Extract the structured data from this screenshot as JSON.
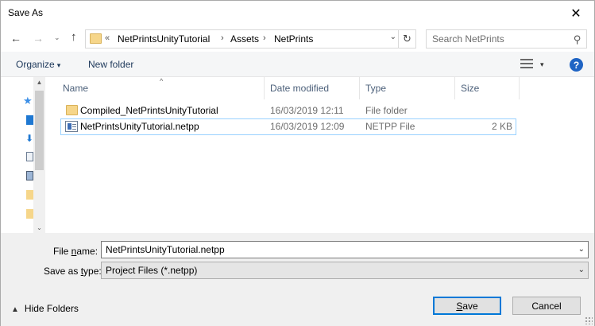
{
  "window": {
    "title": "Save As",
    "close_glyph": "✕"
  },
  "nav": {
    "back_glyph": "←",
    "forward_glyph": "→",
    "recent_glyph": "⌄",
    "up_glyph": "↑",
    "overflow_chevron": "«",
    "breadcrumbs": [
      "NetPrintsUnityTutorial",
      "Assets",
      "NetPrints"
    ],
    "separator": "›",
    "dropdown_glyph": "⌄",
    "refresh_glyph": "↻"
  },
  "search": {
    "placeholder": "Search NetPrints",
    "icon_glyph": "⚲"
  },
  "toolbar": {
    "organize_label": "Organize",
    "organize_caret": "▾",
    "new_folder_label": "New folder",
    "view_caret": "▾",
    "help_glyph": "?"
  },
  "columns": {
    "name": "Name",
    "date_modified": "Date modified",
    "type": "Type",
    "size": "Size",
    "sort_glyph": "^"
  },
  "files": [
    {
      "name": "Compiled_NetPrintsUnityTutorial",
      "date": "16/03/2019 12:11",
      "type": "File folder",
      "size": "",
      "icon": "folder-icon"
    },
    {
      "name": "NetPrintsUnityTutorial.netpp",
      "date": "16/03/2019 12:09",
      "type": "NETPP File",
      "size": "2 KB",
      "icon": "netpp-file-icon"
    }
  ],
  "scrollbar": {
    "up_glyph": "▲",
    "down_glyph": "⌄"
  },
  "form": {
    "file_name_label_pre": "File ",
    "file_name_label_key": "n",
    "file_name_label_post": "ame:",
    "file_name_value": "NetPrintsUnityTutorial.netpp",
    "save_type_label_pre": "Save as ",
    "save_type_label_key": "t",
    "save_type_label_post": "ype:",
    "save_type_value": "Project Files (*.netpp)",
    "dropdown_glyph": "⌄"
  },
  "footer": {
    "hide_folders_caret": "▲",
    "hide_folders_label": "Hide Folders",
    "save_key": "S",
    "save_rest": "ave",
    "cancel_label": "Cancel"
  },
  "colors": {
    "accent": "#0078d7",
    "help_blue": "#1f64c4",
    "selection_border": "#99d1ff",
    "folder_yellow": "#f6d68a"
  }
}
